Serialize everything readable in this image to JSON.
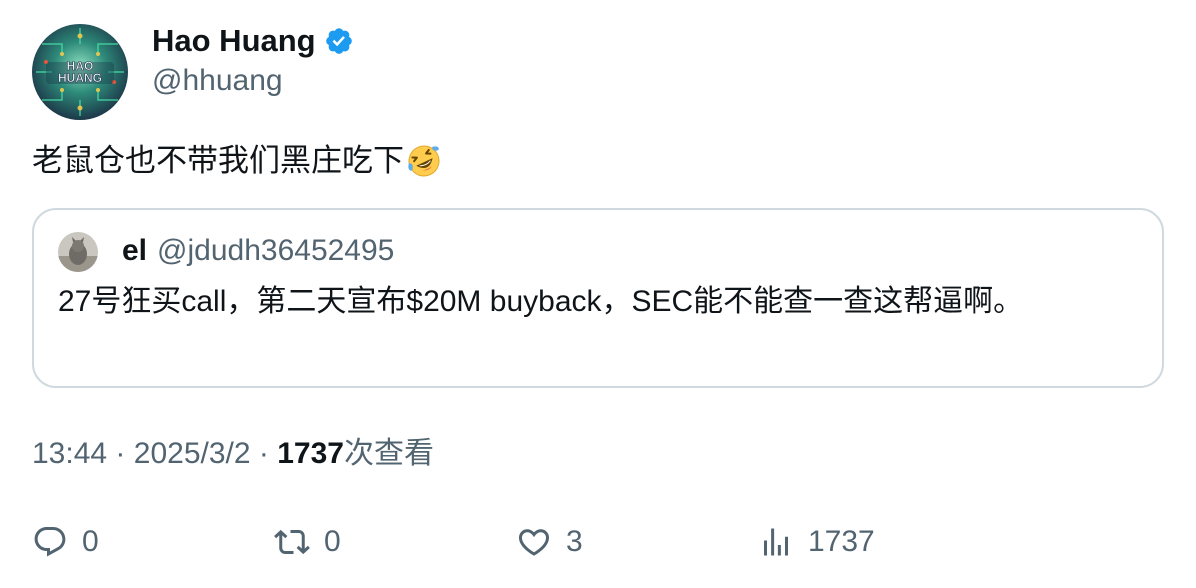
{
  "author": {
    "name": "Hao Huang",
    "handle": "@hhuang",
    "avatar_text_line1": "HAO",
    "avatar_text_line2": "HUANG",
    "verified": true
  },
  "tweet": {
    "text": "老鼠仓也不带我们黑庄吃下",
    "emoji": "rolling-on-the-floor-laughing"
  },
  "quote": {
    "name": "el",
    "handle": "@jdudh36452495",
    "text": "27号狂买call，第二天宣布$20M buyback，SEC能不能查一查这帮逼啊。"
  },
  "meta": {
    "time": "13:44",
    "separator": "·",
    "date": "2025/3/2",
    "views_count": "1737",
    "views_label": "次查看"
  },
  "actions": {
    "reply_count": "0",
    "retweet_count": "0",
    "like_count": "3",
    "views_count": "1737"
  },
  "colors": {
    "text_primary": "#0f1419",
    "text_secondary": "#536471",
    "border": "#cfd9de",
    "verified": "#1d9bf0"
  }
}
